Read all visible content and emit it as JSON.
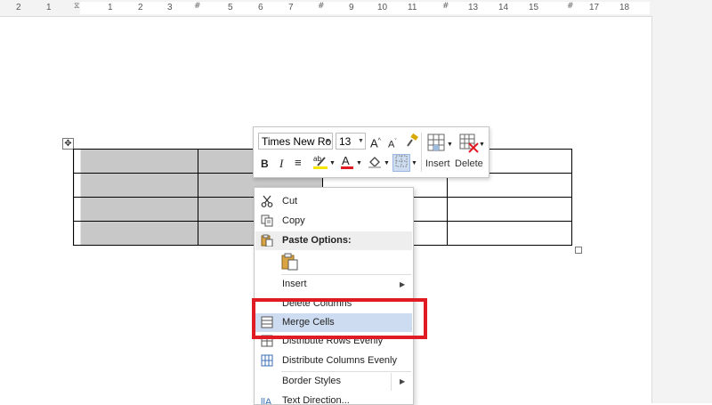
{
  "ruler": {
    "numbers_left": [
      "2",
      "1"
    ],
    "numbers_right": [
      "1",
      "2",
      "3",
      "4",
      "5",
      "6",
      "7",
      "8",
      "9",
      "10",
      "11",
      "12",
      "13",
      "14",
      "15",
      "16",
      "17",
      "18"
    ]
  },
  "mini_toolbar": {
    "font_name": "Times New Roman",
    "font_size": "13",
    "insert_label": "Insert",
    "delete_label": "Delete"
  },
  "context_menu": {
    "cut": "Cut",
    "copy": "Copy",
    "paste_options": "Paste Options:",
    "insert": "Insert",
    "delete_columns": "Delete Columns",
    "merge_cells": "Merge Cells",
    "distribute_rows": "Distribute Rows Evenly",
    "distribute_columns": "Distribute Columns Evenly",
    "border_styles": "Border Styles",
    "text_direction": "Text Direction..."
  },
  "colors": {
    "highlight_box": "#e01b24",
    "selected_cells": "#c8c8c8",
    "menu_hover": "#cddcf0",
    "font_color_bar": "#e01b24",
    "highlight_color_bar": "#f5e600"
  }
}
